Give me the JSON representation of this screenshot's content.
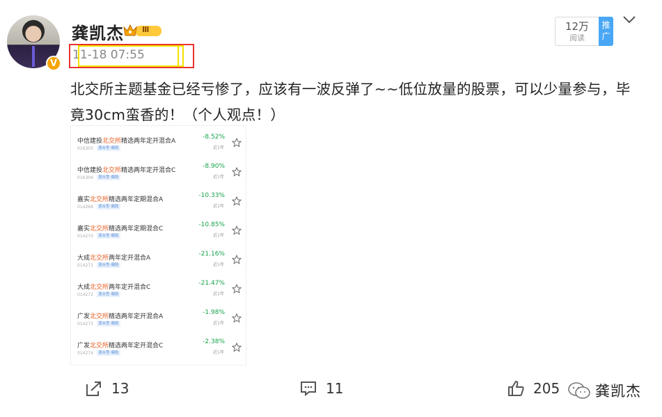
{
  "post": {
    "author": "龚凯杰",
    "rank_badge": "Ⅲ",
    "verified_badge": "V",
    "timestamp": "11-18 07:55",
    "reads_count": "12万",
    "reads_label": "阅读",
    "promo_label": "推广",
    "text": "北交所主题基金已经亏惨了，应该有一波反弹了~~低位放量的股票，可以少量参与，毕竟30cm蛮香的！（个人观点！）"
  },
  "fund_list": [
    {
      "prefix": "中信建投",
      "highlight": "北交所",
      "suffix": "精选两年定开混合A",
      "code": "016303",
      "tag": "混合型-偏股",
      "change": "-8.52%",
      "period": "近1年"
    },
    {
      "prefix": "中信建投",
      "highlight": "北交所",
      "suffix": "精选两年定开混合C",
      "code": "016304",
      "tag": "混合型-偏股",
      "change": "-8.90%",
      "period": "近1年"
    },
    {
      "prefix": "嘉实",
      "highlight": "北交所",
      "suffix": "精选两年定期混合A",
      "code": "014269",
      "tag": "混合型-偏股",
      "change": "-10.33%",
      "period": "近1年"
    },
    {
      "prefix": "嘉实",
      "highlight": "北交所",
      "suffix": "精选两年定期混合C",
      "code": "014270",
      "tag": "混合型-偏股",
      "change": "-10.85%",
      "period": "近1年"
    },
    {
      "prefix": "大成",
      "highlight": "北交所",
      "suffix": "两年定开混合A",
      "code": "014271",
      "tag": "混合型-偏股",
      "change": "-21.16%",
      "period": "近1年"
    },
    {
      "prefix": "大成",
      "highlight": "北交所",
      "suffix": "两年定开混合C",
      "code": "014272",
      "tag": "混合型-偏股",
      "change": "-21.47%",
      "period": "近1年"
    },
    {
      "prefix": "广发",
      "highlight": "北交所",
      "suffix": "精选两年定开混合A",
      "code": "014273",
      "tag": "混合型-偏股",
      "change": "-1.98%",
      "period": "近1年"
    },
    {
      "prefix": "广发",
      "highlight": "北交所",
      "suffix": "精选两年定开混合C",
      "code": "014274",
      "tag": "混合型-偏股",
      "change": "-2.38%",
      "period": "近1年"
    }
  ],
  "footer": {
    "share_count": "13",
    "comment_count": "11",
    "like_count": "205",
    "watermark": "龚凯杰"
  },
  "colors": {
    "highlight_box": "#e8342e",
    "marker_box": "#f4e300",
    "promo": "#49a7f5",
    "fund_highlight": "#e55a1c",
    "fund_change": "#16a34a"
  }
}
